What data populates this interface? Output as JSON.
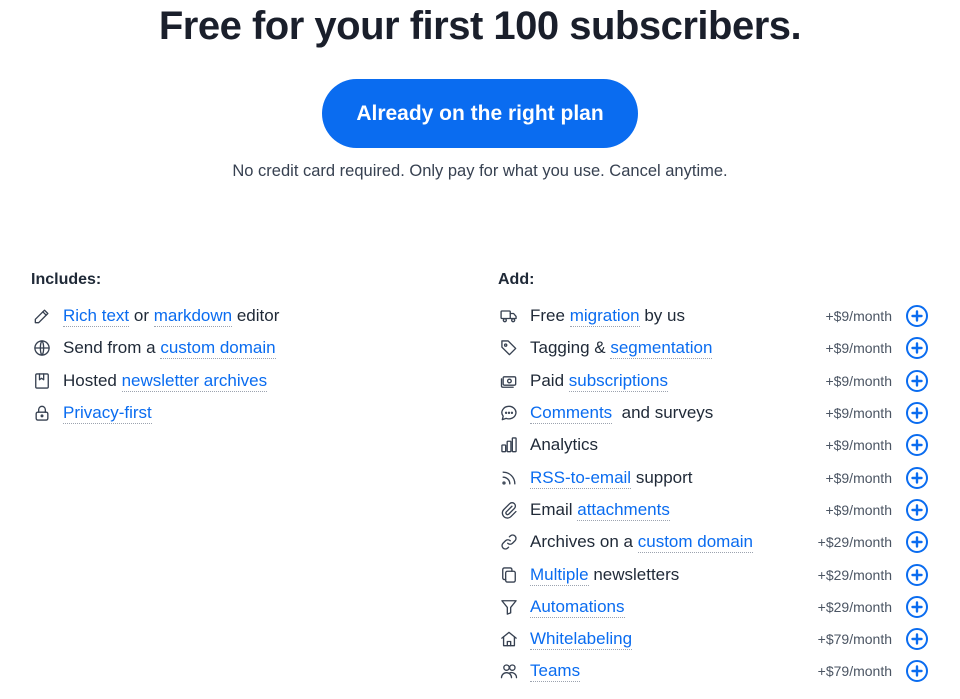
{
  "headline": "Free for your first 100 subscribers.",
  "cta_label": "Already on the right plan",
  "subnote": "No credit card required. Only pay for what you use. Cancel anytime.",
  "includes": {
    "title": "Includes:",
    "items": [
      {
        "icon": "pencil-square-icon",
        "parts": [
          {
            "link": "Rich text"
          },
          {
            "text": " or "
          },
          {
            "link": "markdown"
          },
          {
            "text": " editor"
          }
        ]
      },
      {
        "icon": "globe-icon",
        "parts": [
          {
            "text": "Send from a "
          },
          {
            "link": "custom domain"
          }
        ]
      },
      {
        "icon": "book-icon",
        "parts": [
          {
            "text": "Hosted "
          },
          {
            "link": "newsletter archives"
          }
        ]
      },
      {
        "icon": "lock-icon",
        "parts": [
          {
            "link": "Privacy-first"
          }
        ]
      }
    ]
  },
  "addons": {
    "title": "Add:",
    "items": [
      {
        "icon": "truck-icon",
        "price": "+$9/month",
        "parts": [
          {
            "text": "Free "
          },
          {
            "link": "migration"
          },
          {
            "text": " by us"
          }
        ]
      },
      {
        "icon": "tag-icon",
        "price": "+$9/month",
        "parts": [
          {
            "text": "Tagging & "
          },
          {
            "link": "segmentation"
          }
        ]
      },
      {
        "icon": "cash-icon",
        "price": "+$9/month",
        "parts": [
          {
            "text": "Paid "
          },
          {
            "link": "subscriptions"
          }
        ]
      },
      {
        "icon": "chat-bubble-icon",
        "price": "+$9/month",
        "parts": [
          {
            "link": "Comments"
          },
          {
            "text": "  and surveys"
          }
        ]
      },
      {
        "icon": "bar-chart-icon",
        "price": "+$9/month",
        "parts": [
          {
            "text": "Analytics"
          }
        ]
      },
      {
        "icon": "rss-icon",
        "price": "+$9/month",
        "parts": [
          {
            "link": "RSS-to-email"
          },
          {
            "text": " support"
          }
        ]
      },
      {
        "icon": "paperclip-icon",
        "price": "+$9/month",
        "parts": [
          {
            "text": "Email "
          },
          {
            "link": "attachments"
          }
        ]
      },
      {
        "icon": "link-icon",
        "price": "+$29/month",
        "parts": [
          {
            "text": "Archives on a "
          },
          {
            "link": "custom domain"
          }
        ]
      },
      {
        "icon": "copy-icon",
        "price": "+$29/month",
        "parts": [
          {
            "link": "Multiple"
          },
          {
            "text": " newsletters"
          }
        ]
      },
      {
        "icon": "filter-icon",
        "price": "+$29/month",
        "parts": [
          {
            "link": "Automations"
          }
        ]
      },
      {
        "icon": "home-icon",
        "price": "+$79/month",
        "parts": [
          {
            "link": "Whitelabeling"
          }
        ]
      },
      {
        "icon": "users-icon",
        "price": "+$79/month",
        "parts": [
          {
            "link": "Teams"
          }
        ]
      }
    ]
  },
  "colors": {
    "accent": "#0a6cf0",
    "text": "#1f2937",
    "muted": "#4b5563"
  }
}
